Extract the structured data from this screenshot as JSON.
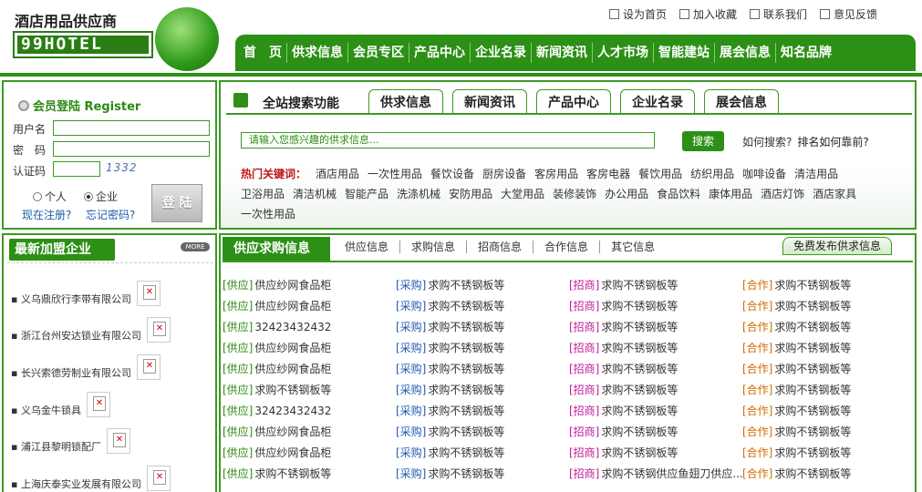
{
  "logo": {
    "name": "酒店用品供应商",
    "wordmark": "99HOTEL"
  },
  "toplinks": [
    "设为首页",
    "加入收藏",
    "联系我们",
    "意见反馈"
  ],
  "nav": [
    "首　页",
    "供求信息",
    "会员专区",
    "产品中心",
    "企业名录",
    "新闻资讯",
    "人才市场",
    "智能建站",
    "展会信息",
    "知名品牌"
  ],
  "login": {
    "title": "会员登陆 Register",
    "username_label": "用户名",
    "password_label": "密　码",
    "captcha_label": "认证码",
    "captcha_value": "1332",
    "radio_personal": "个人",
    "radio_company": "企业",
    "login_button": "登 陆",
    "register_link": "现在注册?",
    "forgot_link": "忘记密码?"
  },
  "search": {
    "title": "全站搜索功能",
    "tabs": [
      "供求信息",
      "新闻资讯",
      "产品中心",
      "企业名录",
      "展会信息"
    ],
    "placeholder": "请输入您感兴趣的供求信息...",
    "button": "搜索",
    "help1": "如何搜索?",
    "help2": "排名如何靠前?",
    "hot_label": "热门关键词：",
    "hot_words": [
      "酒店用品",
      "一次性用品",
      "餐饮设备",
      "厨房设备",
      "客房用品",
      "客房电器",
      "餐饮用品",
      "纺织用品",
      "咖啡设备",
      "清洁用品",
      "卫浴用品",
      "清洁机械",
      "智能产品",
      "洗涤机械",
      "安防用品",
      "大堂用品",
      "装修装饰",
      "办公用品",
      "食品饮料",
      "康体用品",
      "酒店灯饰",
      "酒店家具",
      "一次性用品"
    ]
  },
  "newco": {
    "title": "最新加盟企业",
    "more": "MORE",
    "items": [
      "义乌鼎欣行李带有限公司",
      "浙江台州安达锁业有限公司",
      "长兴索德劳制业有限公司",
      "义乌金牛锁具",
      "浦江县黎明锁配厂",
      "上海庆泰实业发展有限公司"
    ]
  },
  "supply": {
    "title": "供应求购信息",
    "tabs": [
      "供应信息",
      "求购信息",
      "招商信息",
      "合作信息",
      "其它信息"
    ],
    "free_post": "免费发布供求信息",
    "tags": {
      "supply": "[供应]",
      "buy": "[采购]",
      "invest": "[招商]",
      "coop": "[合作]"
    },
    "rows": [
      [
        "供应纱网食品柜",
        "求购不锈钢板等",
        "求购不锈钢板等",
        "求购不锈钢板等"
      ],
      [
        "供应纱网食品柜",
        "求购不锈钢板等",
        "求购不锈钢板等",
        "求购不锈钢板等"
      ],
      [
        "32423432432",
        "求购不锈钢板等",
        "求购不锈钢板等",
        "求购不锈钢板等"
      ],
      [
        "供应纱网食品柜",
        "求购不锈钢板等",
        "求购不锈钢板等",
        "求购不锈钢板等"
      ],
      [
        "供应纱网食品柜",
        "求购不锈钢板等",
        "求购不锈钢板等",
        "求购不锈钢板等"
      ],
      [
        "求购不锈钢板等",
        "求购不锈钢板等",
        "求购不锈钢板等",
        "求购不锈钢板等"
      ],
      [
        "32423432432",
        "求购不锈钢板等",
        "求购不锈钢板等",
        "求购不锈钢板等"
      ],
      [
        "供应纱网食品柜",
        "求购不锈钢板等",
        "求购不锈钢板等",
        "求购不锈钢板等"
      ],
      [
        "供应纱网食品柜",
        "求购不锈钢板等",
        "求购不锈钢板等",
        "求购不锈钢板等"
      ],
      [
        "求购不锈钢板等",
        "求购不锈钢板等",
        "求购不锈钢供应鱼翅刀供应...",
        "求购不锈钢板等"
      ]
    ]
  }
}
